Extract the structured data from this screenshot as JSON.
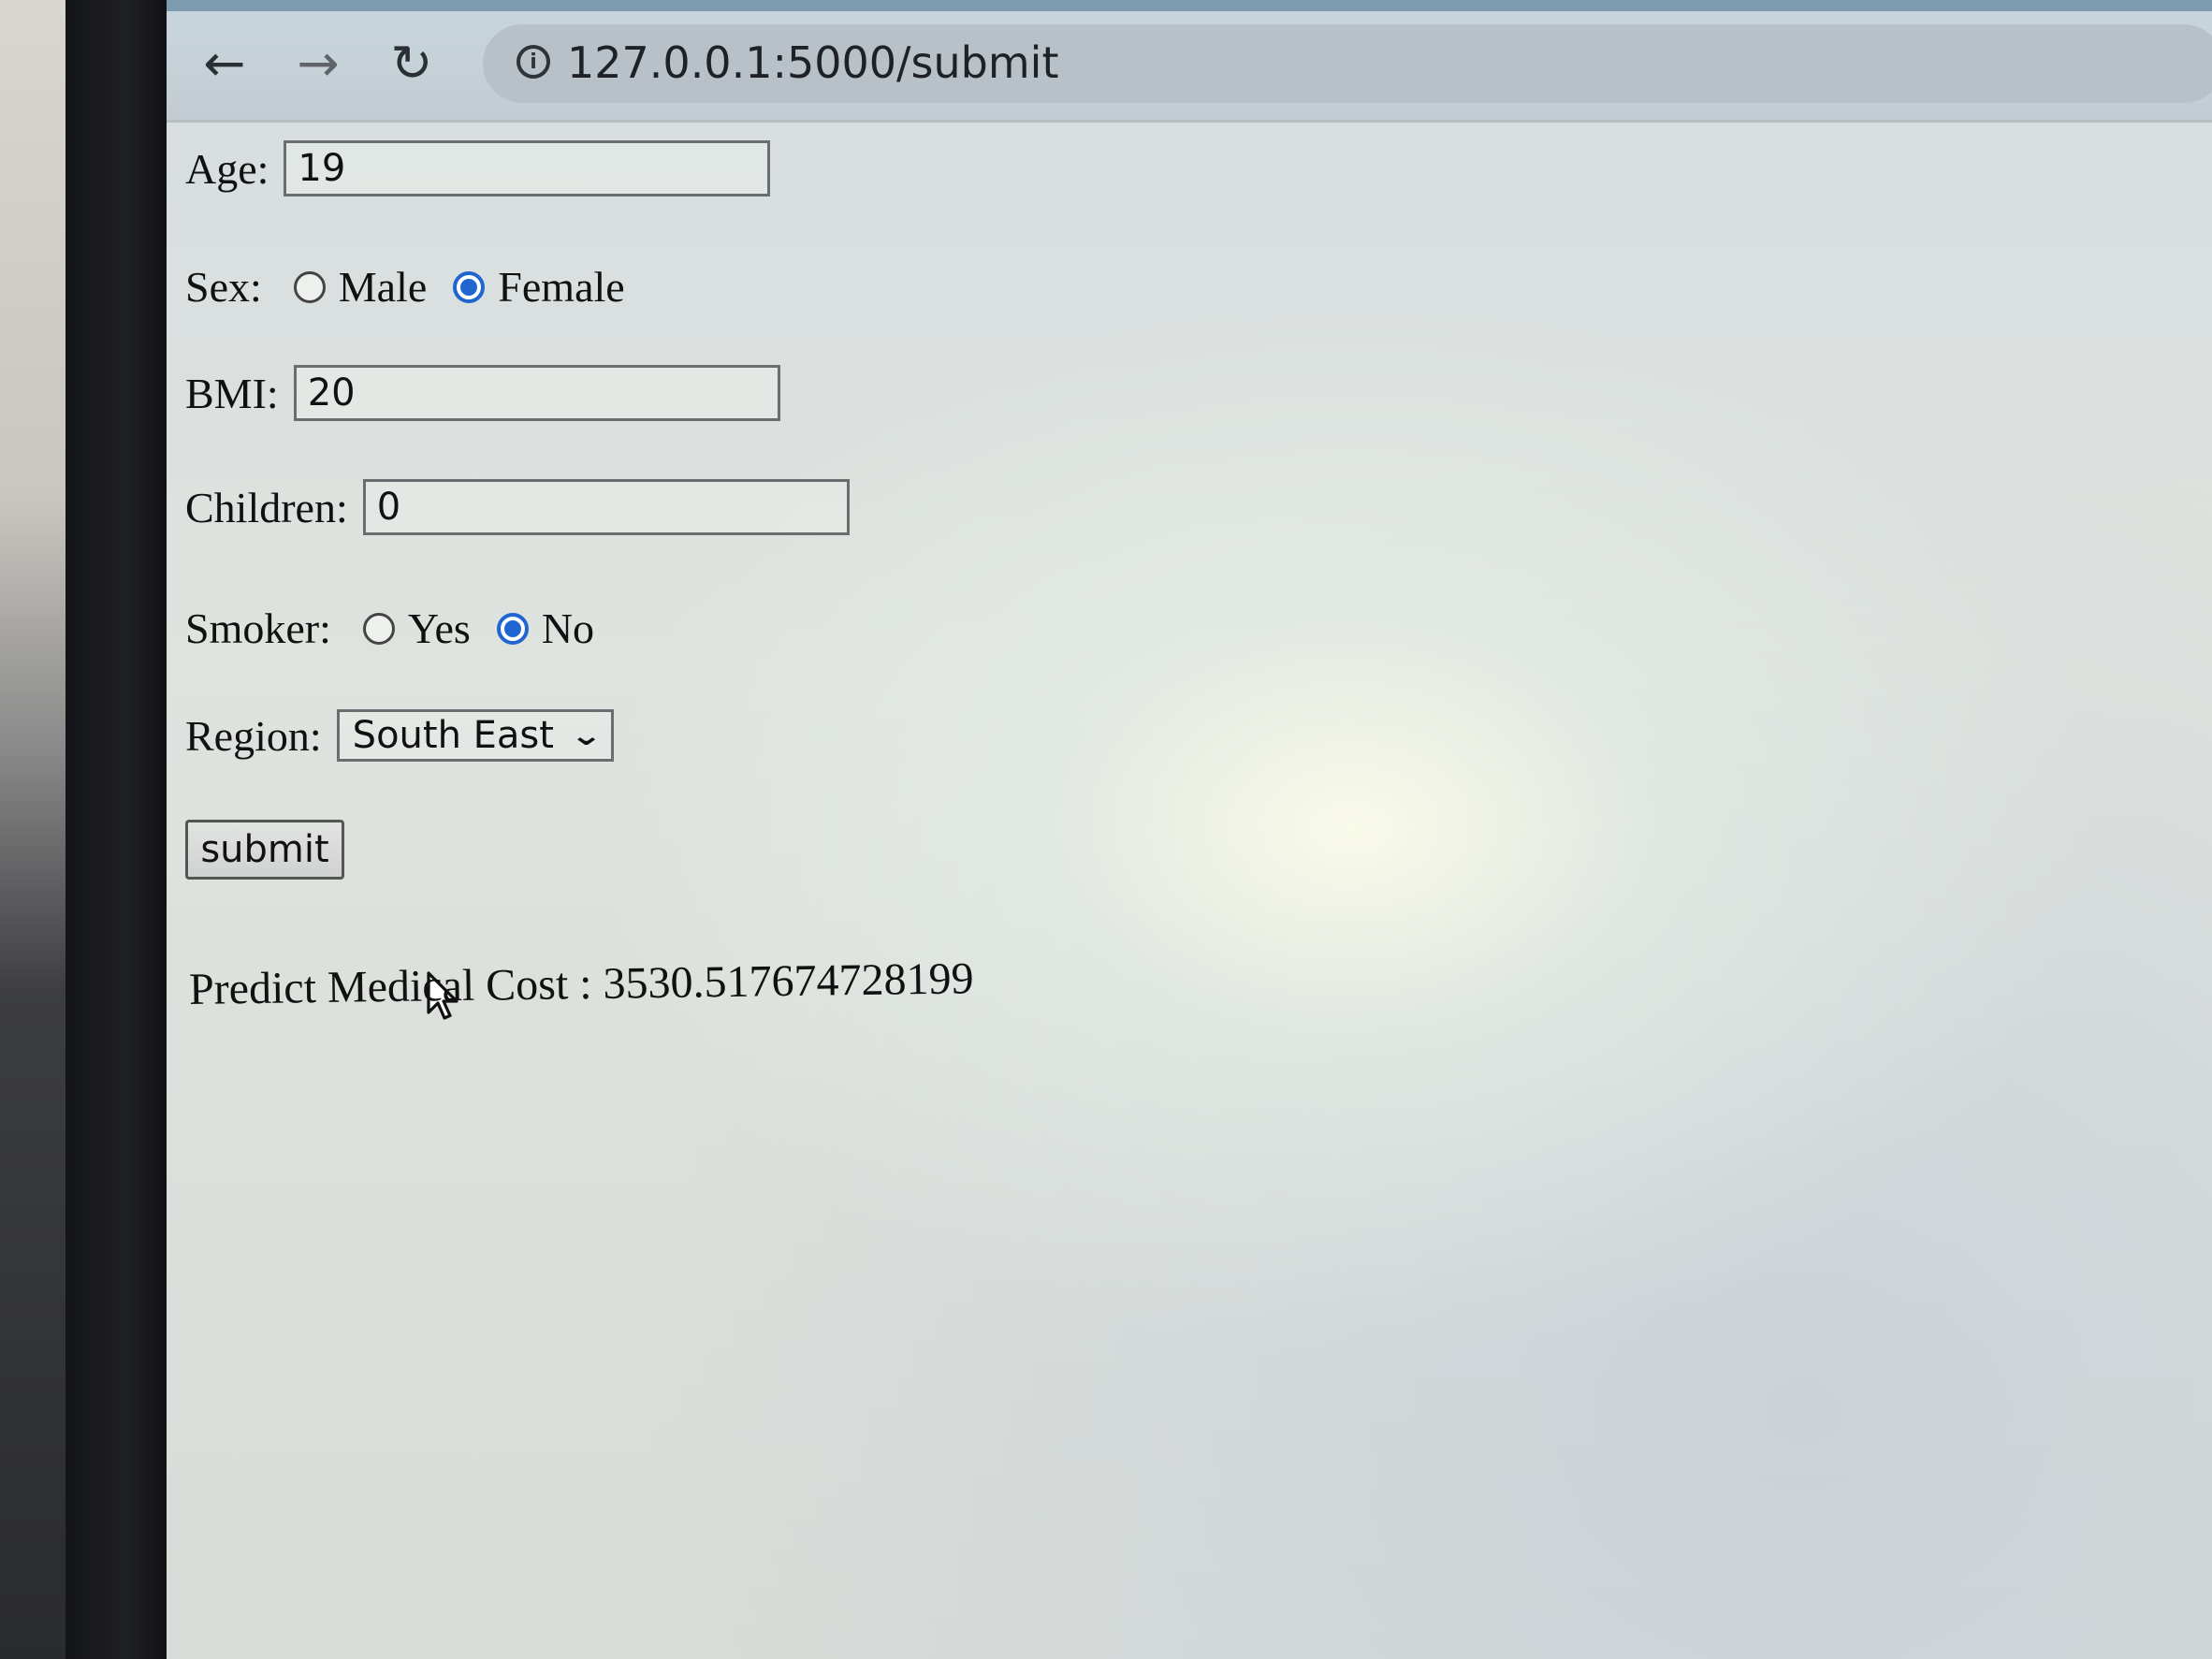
{
  "browser": {
    "url": "127.0.0.1:5000/submit",
    "back_icon": "arrow-left-icon",
    "forward_icon": "arrow-right-icon",
    "reload_icon": "reload-icon",
    "info_icon": "info-icon"
  },
  "form": {
    "age": {
      "label": "Age:",
      "value": "19"
    },
    "sex": {
      "label": "Sex:",
      "options": [
        {
          "label": "Male",
          "checked": false
        },
        {
          "label": "Female",
          "checked": true
        }
      ]
    },
    "bmi": {
      "label": "BMI:",
      "value": "20"
    },
    "children": {
      "label": "Children:",
      "value": "0"
    },
    "smoker": {
      "label": "Smoker:",
      "options": [
        {
          "label": "Yes",
          "checked": false
        },
        {
          "label": "No",
          "checked": true
        }
      ]
    },
    "region": {
      "label": "Region:",
      "selected": "South East"
    },
    "submit_label": "submit"
  },
  "result": {
    "text": "Predict Medical Cost : 3530.517674728199"
  },
  "colors": {
    "radio_checked": "#1f66d1"
  }
}
